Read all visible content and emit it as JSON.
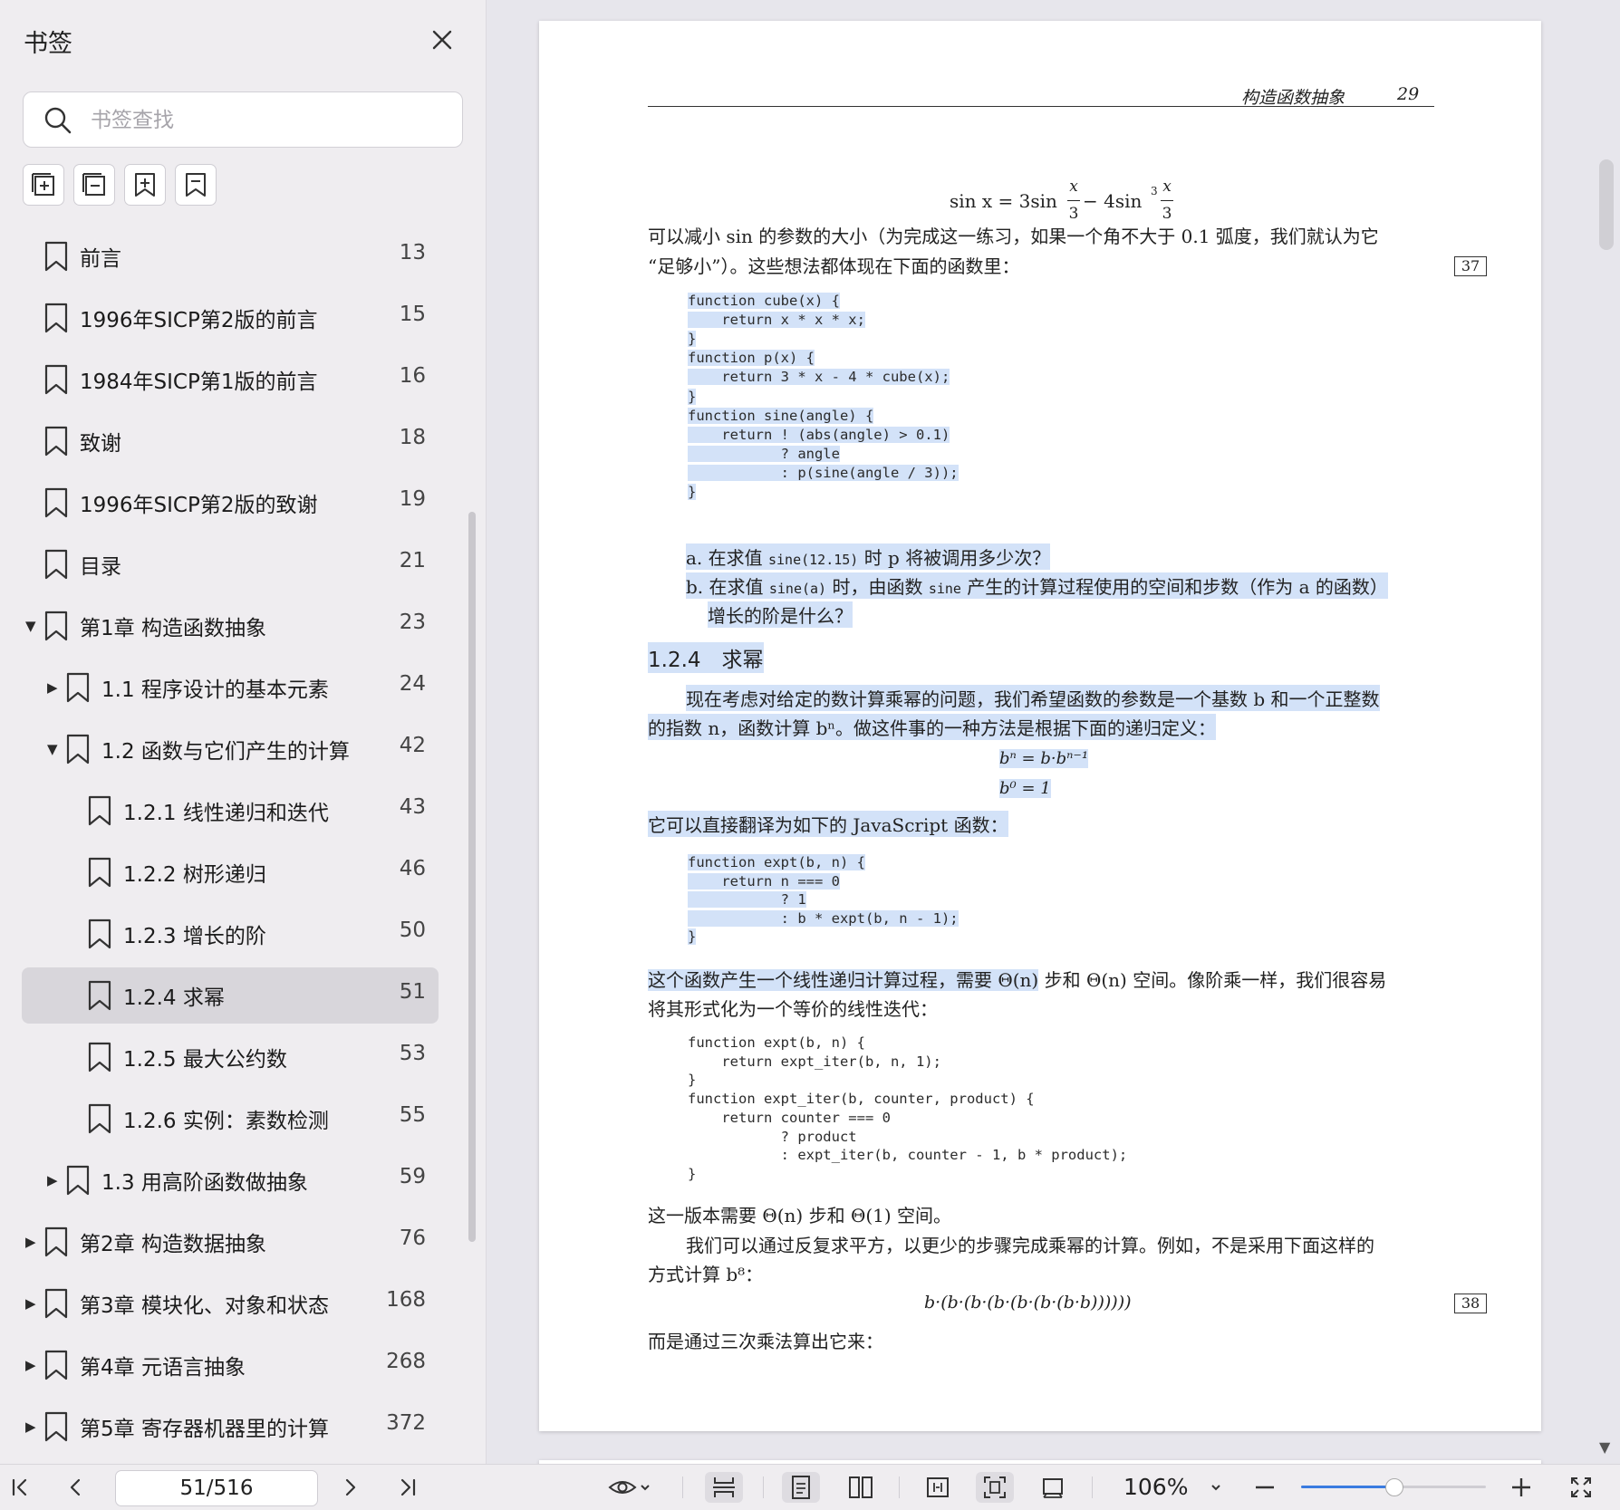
{
  "sidebar": {
    "title": "书签",
    "search_placeholder": "书签查找",
    "items": [
      {
        "label": "前言",
        "page": "13",
        "level": 0,
        "caret": ""
      },
      {
        "label": "1996年SICP第2版的前言",
        "page": "15",
        "level": 0,
        "caret": ""
      },
      {
        "label": "1984年SICP第1版的前言",
        "page": "16",
        "level": 0,
        "caret": ""
      },
      {
        "label": "致谢",
        "page": "18",
        "level": 0,
        "caret": ""
      },
      {
        "label": "1996年SICP第2版的致谢",
        "page": "19",
        "level": 0,
        "caret": ""
      },
      {
        "label": "目录",
        "page": "21",
        "level": 0,
        "caret": ""
      },
      {
        "label": "第1章 构造函数抽象",
        "page": "23",
        "level": 0,
        "caret": "▼"
      },
      {
        "label": "1.1 程序设计的基本元素",
        "page": "24",
        "level": 1,
        "caret": "▶"
      },
      {
        "label": "1.2 函数与它们产生的计算",
        "page": "42",
        "level": 1,
        "caret": "▼"
      },
      {
        "label": "1.2.1 线性递归和迭代",
        "page": "43",
        "level": 2,
        "caret": ""
      },
      {
        "label": "1.2.2 树形递归",
        "page": "46",
        "level": 2,
        "caret": ""
      },
      {
        "label": "1.2.3 增长的阶",
        "page": "50",
        "level": 2,
        "caret": ""
      },
      {
        "label": "1.2.4 求幂",
        "page": "51",
        "level": 2,
        "caret": "",
        "active": true
      },
      {
        "label": "1.2.5 最大公约数",
        "page": "53",
        "level": 2,
        "caret": ""
      },
      {
        "label": "1.2.6 实例：素数检测",
        "page": "55",
        "level": 2,
        "caret": ""
      },
      {
        "label": "1.3 用高阶函数做抽象",
        "page": "59",
        "level": 1,
        "caret": "▶"
      },
      {
        "label": "第2章 构造数据抽象",
        "page": "76",
        "level": 0,
        "caret": "▶"
      },
      {
        "label": "第3章 模块化、对象和状态",
        "page": "168",
        "level": 0,
        "caret": "▶"
      },
      {
        "label": "第4章 元语言抽象",
        "page": "268",
        "level": 0,
        "caret": "▶"
      },
      {
        "label": "第5章 寄存器机器里的计算",
        "page": "372",
        "level": 0,
        "caret": "▶"
      }
    ]
  },
  "page": {
    "running_head": "构造函数抽象",
    "page_number": "29",
    "formula_top": {
      "lhs": "sin x = 3sin",
      "num1": "x",
      "den1": "3",
      "mid": "− 4sin",
      "sup": "3",
      "num2": "x",
      "den2": "3"
    },
    "para1_line1": "可以减小 sin 的参数的大小（为完成这一练习，如果一个角不大于 0.1 弧度，我们就认为它",
    "para1_line2": "“足够小”）。这些想法都体现在下面的函数里：",
    "margin_ref_1": "37",
    "code1": [
      "function cube(x) {",
      "    return x * x * x;",
      "}",
      "function p(x) {",
      "    return 3 * x - 4 * cube(x);",
      "}",
      "function sine(angle) {",
      "    return ! (abs(angle) > 0.1)",
      "           ? angle",
      "           : p(sine(angle / 3));",
      "}"
    ],
    "q_a_prefix": "a. 在求值 ",
    "q_a_code": "sine(12.15)",
    "q_a_suffix": " 时 p 将被调用多少次？",
    "q_b_prefix": "b. 在求值 ",
    "q_b_code": "sine(a)",
    "q_b_mid": " 时，由函数 ",
    "q_b_code2": "sine",
    "q_b_suffix": " 产生的计算过程使用的空间和步数（作为 a 的函数）",
    "q_b_line2": "增长的阶是什么？",
    "section_heading": "1.2.4　求幂",
    "para2_line1": "现在考虑对给定的数计算乘幂的问题，我们希望函数的参数是一个基数 b 和一个正整数",
    "para2_line2": "的指数 n，函数计算 bⁿ。做这件事的一种方法是根据下面的递归定义：",
    "rec_def_1": "bⁿ = b·bⁿ⁻¹",
    "rec_def_2": "b⁰ = 1",
    "para3": "它可以直接翻译为如下的 JavaScript 函数：",
    "code2": [
      "function expt(b, n) {",
      "    return n === 0",
      "           ? 1",
      "           : b * expt(b, n - 1);",
      "}"
    ],
    "para4_hl": "这个函数产生一个线性递归计算过程，需要 Θ(n)",
    "para4_rest": " 步和 Θ(n) 空间。像阶乘一样，我们很容易",
    "para4_line2": "将其形式化为一个等价的线性迭代：",
    "code3": [
      "function expt(b, n) {",
      "    return expt_iter(b, n, 1);",
      "}",
      "function expt_iter(b, counter, product) {",
      "    return counter === 0",
      "           ? product",
      "           : expt_iter(b, counter - 1, b * product);",
      "}"
    ],
    "para5": "这一版本需要 Θ(n) 步和 Θ(1) 空间。",
    "para6_line1": "我们可以通过反复求平方，以更少的步骤完成乘幂的计算。例如，不是采用下面这样的",
    "para6_line2": "方式计算 b⁸：",
    "formula_b8": "b·(b·(b·(b·(b·(b·(b·b))))))",
    "margin_ref_2": "38",
    "para7": "而是通过三次乘法算出它来："
  },
  "toolbar": {
    "page_field": "51/516",
    "zoom_label": "106%",
    "zoom_fraction": 0.5
  }
}
